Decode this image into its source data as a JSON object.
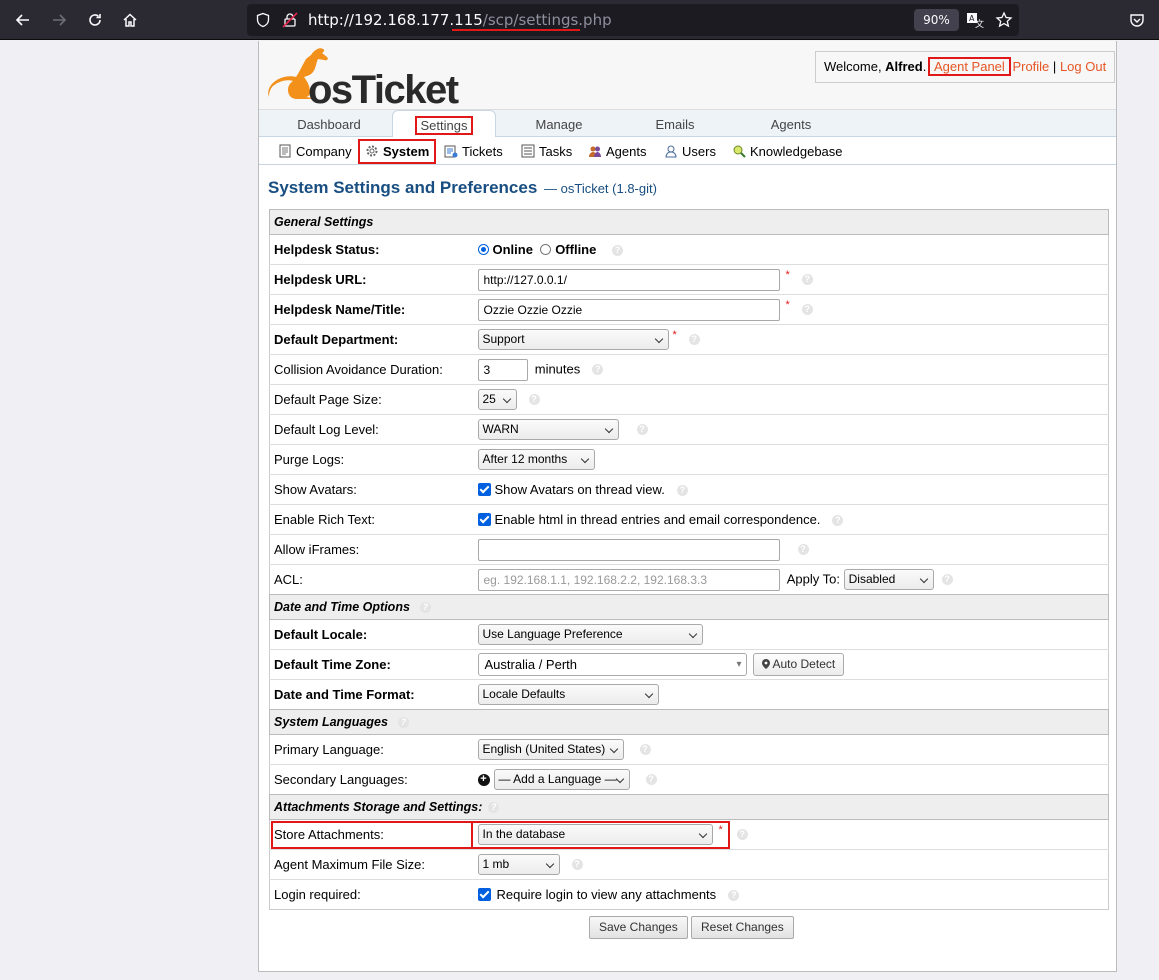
{
  "browser": {
    "url_host": "http://192.168.177.115",
    "url_path": "/scp/settings.php",
    "zoom": "90%"
  },
  "header": {
    "logo_text": "osTicket",
    "welcome_prefix": "Welcome, ",
    "user_name": "Alfred",
    "agent_panel": "Agent Panel",
    "profile": "Profile",
    "separator": "|",
    "logout": "Log Out"
  },
  "nav": {
    "tabs": [
      "Dashboard",
      "Settings",
      "Manage",
      "Emails",
      "Agents"
    ],
    "active": "Settings"
  },
  "subnav": {
    "items": [
      "Company",
      "System",
      "Tickets",
      "Tasks",
      "Agents",
      "Users",
      "Knowledgebase"
    ],
    "active": "System"
  },
  "page": {
    "title": "System Settings and Preferences",
    "subtitle": "— osTicket (1.8-git)"
  },
  "sections": {
    "general": "General Settings",
    "datetime": "Date and Time Options",
    "languages": "System Languages",
    "attachments": "Attachments Storage and Settings:"
  },
  "general": {
    "status_label": "Helpdesk Status:",
    "status_online": "Online",
    "status_offline": "Offline",
    "url_label": "Helpdesk URL:",
    "url_value": "http://127.0.0.1/",
    "name_label": "Helpdesk Name/Title:",
    "name_value": "Ozzie Ozzie Ozzie",
    "dept_label": "Default Department:",
    "dept_value": "Support",
    "collision_label": "Collision Avoidance Duration:",
    "collision_value": "3",
    "collision_unit": "minutes",
    "pagesize_label": "Default Page Size:",
    "pagesize_value": "25",
    "loglevel_label": "Default Log Level:",
    "loglevel_value": "WARN",
    "purge_label": "Purge Logs:",
    "purge_value": "After 12 months",
    "avatars_label": "Show Avatars:",
    "avatars_text": "Show Avatars on thread view.",
    "richtext_label": "Enable Rich Text:",
    "richtext_text": "Enable html in thread entries and email correspondence.",
    "iframes_label": "Allow iFrames:",
    "acl_label": "ACL:",
    "acl_placeholder": "eg. 192.168.1.1, 192.168.2.2, 192.168.3.3",
    "apply_to_label": "Apply To:",
    "apply_to_value": "Disabled"
  },
  "datetime": {
    "locale_label": "Default Locale:",
    "locale_value": "Use Language Preference",
    "tz_label": "Default Time Zone:",
    "tz_value": "Australia / Perth",
    "auto_detect": "Auto Detect",
    "format_label": "Date and Time Format:",
    "format_value": "Locale Defaults"
  },
  "languages": {
    "primary_label": "Primary Language:",
    "primary_value": "English (United States)",
    "secondary_label": "Secondary Languages:",
    "secondary_value": "— Add a Language —"
  },
  "attachments": {
    "store_label": "Store Attachments:",
    "store_value": "In the database",
    "maxsize_label": "Agent Maximum File Size:",
    "maxsize_value": "1 mb",
    "login_label": "Login required:",
    "login_text": "Require login to view any attachments"
  },
  "buttons": {
    "save": "Save Changes",
    "reset": "Reset Changes"
  },
  "colors": {
    "title_blue": "#184e81",
    "link_orange": "#e65524",
    "highlight_red": "#e01818",
    "checkbox_blue": "#0060df"
  }
}
